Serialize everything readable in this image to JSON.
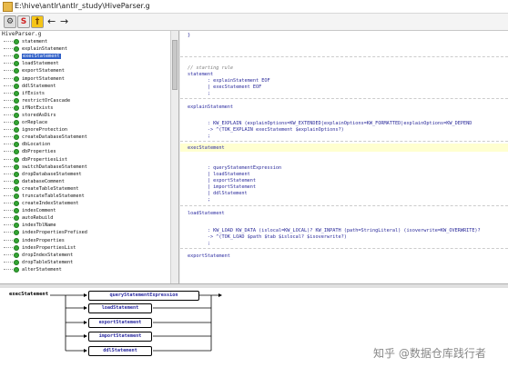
{
  "window": {
    "title": "E:\\hive\\antlr\\antlr_study\\HiveParser.g"
  },
  "toolbar": {
    "gear_label": "⚙",
    "s_label": "S",
    "y_label": "†",
    "back_label": "←",
    "fwd_label": "→"
  },
  "nav": {
    "file": "HiveParser.g",
    "selected": "execStatement",
    "rules": [
      "statement",
      "explainStatement",
      "execStatement",
      "loadStatement",
      "exportStatement",
      "importStatement",
      "ddlStatement",
      "ifExists",
      "restrictOrCascade",
      "ifNotExists",
      "storedAsDirs",
      "orReplace",
      "ignoreProtection",
      "createDatabaseStatement",
      "dbLocation",
      "dbProperties",
      "dbPropertiesList",
      "switchDatabaseStatement",
      "dropDatabaseStatement",
      "databaseComment",
      "createTableStatement",
      "truncateTableStatement",
      "createIndexStatement",
      "indexComment",
      "autoRebuild",
      "indexTblName",
      "indexPropertiesPrefixed",
      "indexProperties",
      "indexPropertiesList",
      "dropIndexStatement",
      "dropTableStatement",
      "alterStatement"
    ]
  },
  "editor": {
    "l1": "}",
    "l2": "// starting rule",
    "l3": "statement",
    "l4": "       : explainStatement EOF",
    "l5": "       | execStatement EOF",
    "l6": "       ;",
    "l7": "explainStatement",
    "l8": "       : KW_EXPLAIN (explainOptions=KW_EXTENDED|explainOptions=KW_FORMATTED|explainOptions=KW_DEPEND",
    "l9": "       -> ^(TOK_EXPLAIN execStatement $explainOptions?)",
    "l10": "       ;",
    "l11": "execStatement",
    "l12": "       : queryStatementExpression",
    "l13": "       | loadStatement",
    "l14": "       | exportStatement",
    "l15": "       | importStatement",
    "l16": "       | ddlStatement",
    "l17": "       ;",
    "l18": "loadStatement",
    "l19": "       : KW_LOAD KW_DATA (islocal=KW_LOCAL)? KW_INPATH (path=StringLiteral) (isoverwrite=KW_OVERWRITE)?",
    "l20": "       -> ^(TOK_LOAD $path $tab $islocal? $isoverwrite?)",
    "l21": "       ;",
    "l22": "exportStatement"
  },
  "syntax": {
    "rule_name": "execStatement",
    "alts": [
      "queryStatementExpression",
      "loadStatement",
      "exportStatement",
      "importStatement",
      "ddlStatement"
    ]
  },
  "watermark": "知乎 @数据仓库践行者"
}
